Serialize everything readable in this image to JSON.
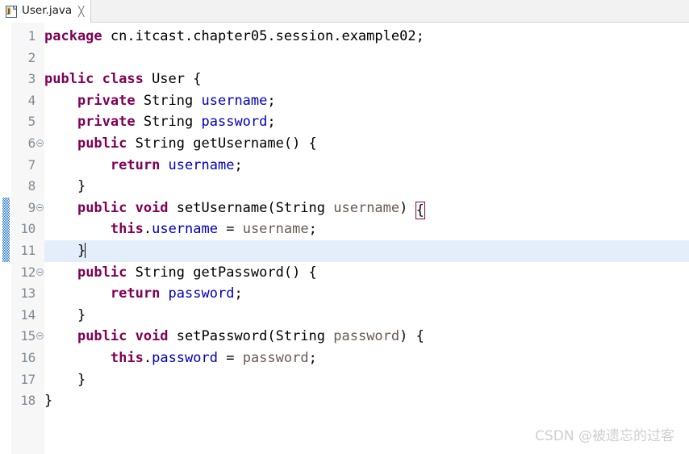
{
  "window": {
    "app": "Eclipse IDE",
    "background": "#ffffff"
  },
  "tabbar": {
    "tabs": [
      {
        "label": "User.java",
        "icon": "java-file-icon",
        "close_glyph": "╳",
        "active": true
      }
    ]
  },
  "editor": {
    "language": "java",
    "colors": {
      "keyword": "#7f0055",
      "field": "#0000c0",
      "parameter": "#6a5a55",
      "plain": "#000000",
      "current_line_highlight": "#e4eefb",
      "gutter_background": "#f7f7f7",
      "line_number": "#808b96",
      "change_bar": "#1a72c4",
      "bracket_match_outline": "#7f0055"
    },
    "current_line": 11,
    "change_bar_lines": [
      9,
      10,
      11
    ],
    "fold_lines": [
      6,
      9,
      12,
      15
    ],
    "caret": {
      "line": 11,
      "after": "}"
    },
    "lines": [
      {
        "number": "1",
        "tokens": [
          {
            "t": "package ",
            "c": "kw"
          },
          {
            "t": "cn.itcast.chapter05.session.example02;",
            "c": "pln"
          }
        ]
      },
      {
        "number": "2",
        "tokens": []
      },
      {
        "number": "3",
        "tokens": [
          {
            "t": "public class ",
            "c": "kw"
          },
          {
            "t": "User {",
            "c": "pln"
          }
        ]
      },
      {
        "number": "4",
        "tokens": [
          {
            "t": "    ",
            "c": "pln"
          },
          {
            "t": "private ",
            "c": "kw"
          },
          {
            "t": "String ",
            "c": "pln"
          },
          {
            "t": "username",
            "c": "fld"
          },
          {
            "t": ";",
            "c": "pln"
          }
        ]
      },
      {
        "number": "5",
        "tokens": [
          {
            "t": "    ",
            "c": "pln"
          },
          {
            "t": "private ",
            "c": "kw"
          },
          {
            "t": "String ",
            "c": "pln"
          },
          {
            "t": "password",
            "c": "fld"
          },
          {
            "t": ";",
            "c": "pln"
          }
        ]
      },
      {
        "number": "6",
        "fold": true,
        "tokens": [
          {
            "t": "    ",
            "c": "pln"
          },
          {
            "t": "public ",
            "c": "kw"
          },
          {
            "t": "String getUsername() {",
            "c": "pln"
          }
        ]
      },
      {
        "number": "7",
        "tokens": [
          {
            "t": "        ",
            "c": "pln"
          },
          {
            "t": "return ",
            "c": "kw"
          },
          {
            "t": "username",
            "c": "fld"
          },
          {
            "t": ";",
            "c": "pln"
          }
        ]
      },
      {
        "number": "8",
        "tokens": [
          {
            "t": "    }",
            "c": "pln"
          }
        ]
      },
      {
        "number": "9",
        "fold": true,
        "change": true,
        "tokens": [
          {
            "t": "    ",
            "c": "pln"
          },
          {
            "t": "public void ",
            "c": "kw"
          },
          {
            "t": "setUsername(String ",
            "c": "pln"
          },
          {
            "t": "username",
            "c": "par"
          },
          {
            "t": ") ",
            "c": "pln"
          },
          {
            "t": "{",
            "c": "pln",
            "bracket": true
          }
        ]
      },
      {
        "number": "10",
        "change": true,
        "tokens": [
          {
            "t": "        ",
            "c": "pln"
          },
          {
            "t": "this",
            "c": "kw"
          },
          {
            "t": ".",
            "c": "pln"
          },
          {
            "t": "username",
            "c": "fld"
          },
          {
            "t": " = ",
            "c": "pln"
          },
          {
            "t": "username",
            "c": "par"
          },
          {
            "t": ";",
            "c": "pln"
          }
        ]
      },
      {
        "number": "11",
        "change": true,
        "current": true,
        "tokens": [
          {
            "t": "    }",
            "c": "pln"
          }
        ],
        "caret": true
      },
      {
        "number": "12",
        "fold": true,
        "tokens": [
          {
            "t": "    ",
            "c": "pln"
          },
          {
            "t": "public ",
            "c": "kw"
          },
          {
            "t": "String getPassword() {",
            "c": "pln"
          }
        ]
      },
      {
        "number": "13",
        "tokens": [
          {
            "t": "        ",
            "c": "pln"
          },
          {
            "t": "return ",
            "c": "kw"
          },
          {
            "t": "password",
            "c": "fld"
          },
          {
            "t": ";",
            "c": "pln"
          }
        ]
      },
      {
        "number": "14",
        "tokens": [
          {
            "t": "    }",
            "c": "pln"
          }
        ]
      },
      {
        "number": "15",
        "fold": true,
        "tokens": [
          {
            "t": "    ",
            "c": "pln"
          },
          {
            "t": "public void ",
            "c": "kw"
          },
          {
            "t": "setPassword(String ",
            "c": "pln"
          },
          {
            "t": "password",
            "c": "par"
          },
          {
            "t": ") {",
            "c": "pln"
          }
        ]
      },
      {
        "number": "16",
        "tokens": [
          {
            "t": "        ",
            "c": "pln"
          },
          {
            "t": "this",
            "c": "kw"
          },
          {
            "t": ".",
            "c": "pln"
          },
          {
            "t": "password",
            "c": "fld"
          },
          {
            "t": " = ",
            "c": "pln"
          },
          {
            "t": "password",
            "c": "par"
          },
          {
            "t": ";",
            "c": "pln"
          }
        ]
      },
      {
        "number": "17",
        "tokens": [
          {
            "t": "    }",
            "c": "pln"
          }
        ]
      },
      {
        "number": "18",
        "tokens": [
          {
            "t": "}",
            "c": "pln"
          }
        ]
      }
    ]
  },
  "watermark": {
    "text": "CSDN @被遗忘的过客"
  }
}
